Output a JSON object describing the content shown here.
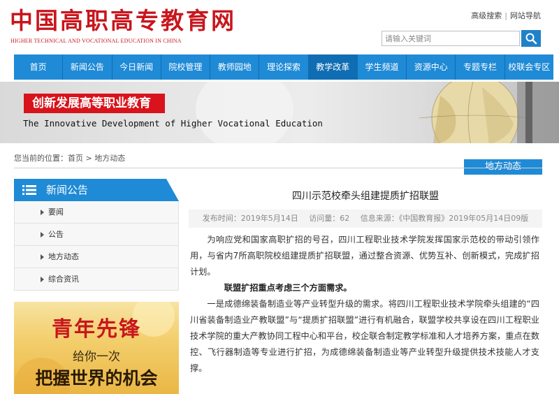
{
  "header": {
    "logo_cn": "中国高职高专教育网",
    "logo_en": "HIGHER TECHNICAL AND VOCATIONAL EDUCATION IN CHINA",
    "links": [
      "高级搜索",
      "网站导航"
    ],
    "search": {
      "placeholder": "请输入关键词"
    }
  },
  "nav": {
    "items": [
      "首页",
      "新闻公告",
      "今日新闻",
      "院校管理",
      "教师园地",
      "理论探索",
      "教学改革",
      "学生频道",
      "资源中心",
      "专题专栏",
      "校联会专区"
    ],
    "active_index": 6
  },
  "banner": {
    "cn": "创新发展高等职业教育",
    "en": "The Innovative Development of Higher Vocational Education"
  },
  "breadcrumb": {
    "prefix": "您当前的位置：",
    "home": "首页",
    "sep": ">",
    "current": "地方动态"
  },
  "category_tab": "地方动态",
  "sidebar": {
    "title": "新闻公告",
    "items": [
      "要闻",
      "公告",
      "地方动态",
      "综合资讯"
    ]
  },
  "promo": {
    "line1": "青年先锋",
    "line2": "给你一次",
    "line3": "把握世界的机会"
  },
  "article": {
    "title": "四川示范校牵头组建提质扩招联盟",
    "meta": {
      "date": "发布时间：2019年5月14日",
      "views": "访问量：62",
      "source": "信息来源：《中国教育报》2019年05月14日09版"
    },
    "paragraphs": [
      "为响应党和国家高职扩招的号召，四川工程职业技术学院发挥国家示范校的带动引领作用，与省内7所高职院校组建提质扩招联盟，通过整合资源、优势互补、创新模式，完成扩招计划。",
      "联盟扩招重点考虑三个方面需求。",
      "一是成德绵装备制造业等产业转型升级的需求。将四川工程职业技术学院牵头组建的“四川省装备制造业产教联盟”与“提质扩招联盟”进行有机融合，联盟学校共享设在四川工程职业技术学院的重大产教协同工程中心和平台，校企联合制定教学标准和人才培养方案，重点在数控、飞行器制造等专业进行扩招，为成德绵装备制造业等产业转型升级提供技术技能人才支撑。"
    ]
  },
  "colors": {
    "brand_red": "#c8161d",
    "nav_blue": "#1f8ad6",
    "nav_active": "#0f6db3"
  }
}
